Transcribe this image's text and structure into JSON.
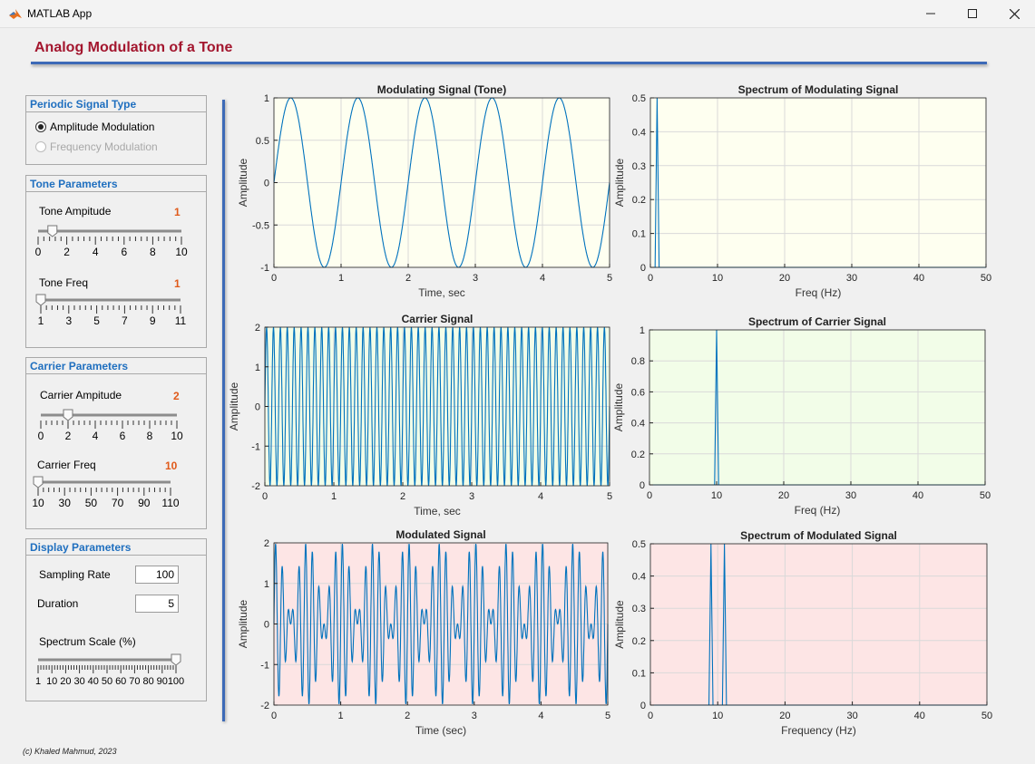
{
  "window": {
    "title": "MATLAB App"
  },
  "app": {
    "title": "Analog Modulation of a Tone",
    "footer": "(c) Khaled Mahmud, 2023"
  },
  "signal_type": {
    "title": "Periodic Signal Type",
    "options": [
      {
        "label": "Amplitude Modulation",
        "selected": true,
        "enabled": true
      },
      {
        "label": "Frequency Modulation",
        "selected": false,
        "enabled": false
      }
    ]
  },
  "tone": {
    "title": "Tone Parameters",
    "amplitude": {
      "label": "Tone Ampitude",
      "value": "1",
      "min": 0,
      "max": 10,
      "ticks": [
        "0",
        "2",
        "4",
        "6",
        "8",
        "10"
      ]
    },
    "freq": {
      "label": "Tone Freq",
      "value": "1",
      "min": 1,
      "max": 11,
      "ticks": [
        "1",
        "3",
        "5",
        "7",
        "9",
        "11"
      ]
    }
  },
  "carrier": {
    "title": "Carrier Parameters",
    "amplitude": {
      "label": "Carrier Ampitude",
      "value": "2",
      "min": 0,
      "max": 10,
      "ticks": [
        "0",
        "2",
        "4",
        "6",
        "8",
        "10"
      ]
    },
    "freq": {
      "label": "Carrier Freq",
      "value": "10",
      "min": 10,
      "max": 110,
      "ticks": [
        "10",
        "30",
        "50",
        "70",
        "90",
        "110"
      ]
    }
  },
  "display": {
    "title": "Display Parameters",
    "sampling_rate": {
      "label": "Sampling Rate",
      "value": "100"
    },
    "duration": {
      "label": "Duration",
      "value": "5"
    },
    "spectrum_scale": {
      "label": "Spectrum Scale (%)",
      "min": 1,
      "max": 100,
      "value": 100,
      "ticks": [
        "1",
        "10",
        "20",
        "30",
        "40",
        "50",
        "60",
        "70",
        "80",
        "90",
        "100"
      ]
    }
  },
  "colors": {
    "accent": "#3d6ab7",
    "heading": "#a3162e",
    "panel_title": "#1f6fbf",
    "value": "#e05a1a",
    "line": "#0072bd"
  },
  "chart_data": [
    {
      "type": "line",
      "title": "Modulating Signal (Tone)",
      "xlabel": "Time, sec",
      "ylabel": "Amplitude",
      "xlim": [
        0,
        5
      ],
      "ylim": [
        -1,
        1
      ],
      "xticks": [
        "0",
        "1",
        "2",
        "3",
        "4",
        "5"
      ],
      "yticks": [
        "-1",
        "-0.5",
        "0",
        "0.5",
        "1"
      ],
      "bg": "#fefff0",
      "grid": true,
      "signal": {
        "kind": "tone",
        "amplitude": 1,
        "freq": 1,
        "duration": 5
      }
    },
    {
      "type": "line",
      "title": "Spectrum of Modulating Signal",
      "xlabel": "Freq (Hz)",
      "ylabel": "Amplitude",
      "xlim": [
        0,
        50
      ],
      "ylim": [
        0,
        0.5
      ],
      "xticks": [
        "0",
        "10",
        "20",
        "30",
        "40",
        "50"
      ],
      "yticks": [
        "0",
        "0.1",
        "0.2",
        "0.3",
        "0.4",
        "0.5"
      ],
      "bg": "#fefff0",
      "grid": true,
      "peaks": [
        {
          "x": 1,
          "y": 0.5
        }
      ]
    },
    {
      "type": "line",
      "title": "Carrier Signal",
      "xlabel": "Time, sec",
      "ylabel": "Amplitude",
      "xlim": [
        0,
        5
      ],
      "ylim": [
        -2,
        2
      ],
      "xticks": [
        "0",
        "1",
        "2",
        "3",
        "4",
        "5"
      ],
      "yticks": [
        "-2",
        "-1",
        "0",
        "1",
        "2"
      ],
      "bg": "#f2fde8",
      "grid": true,
      "signal": {
        "kind": "carrier",
        "amplitude": 2,
        "freq": 10,
        "duration": 5
      }
    },
    {
      "type": "line",
      "title": "Spectrum of Carrier Signal",
      "xlabel": "Freq (Hz)",
      "ylabel": "Amplitude",
      "xlim": [
        0,
        50
      ],
      "ylim": [
        0,
        1
      ],
      "xticks": [
        "0",
        "10",
        "20",
        "30",
        "40",
        "50"
      ],
      "yticks": [
        "0",
        "0.2",
        "0.4",
        "0.6",
        "0.8",
        "1"
      ],
      "bg": "#f2fde8",
      "grid": true,
      "peaks": [
        {
          "x": 10,
          "y": 1
        }
      ]
    },
    {
      "type": "line",
      "title": "Modulated Signal",
      "xlabel": "Time (sec)",
      "ylabel": "Amplitude",
      "xlim": [
        0,
        5
      ],
      "ylim": [
        -2,
        2
      ],
      "xticks": [
        "0",
        "1",
        "2",
        "3",
        "4",
        "5"
      ],
      "yticks": [
        "-2",
        "-1",
        "0",
        "1",
        "2"
      ],
      "bg": "#fde5e5",
      "grid": true,
      "signal": {
        "kind": "am",
        "carrier_amplitude": 2,
        "carrier_freq": 10,
        "tone_freq": 1,
        "duration": 5
      }
    },
    {
      "type": "line",
      "title": "Spectrum of Modulated Signal",
      "xlabel": "Frequency (Hz)",
      "ylabel": "Amplitude",
      "xlim": [
        0,
        50
      ],
      "ylim": [
        0,
        0.5
      ],
      "xticks": [
        "0",
        "10",
        "20",
        "30",
        "40",
        "50"
      ],
      "yticks": [
        "0",
        "0.1",
        "0.2",
        "0.3",
        "0.4",
        "0.5"
      ],
      "bg": "#fde5e5",
      "grid": true,
      "peaks": [
        {
          "x": 9,
          "y": 0.5
        },
        {
          "x": 11,
          "y": 0.5
        }
      ]
    }
  ]
}
